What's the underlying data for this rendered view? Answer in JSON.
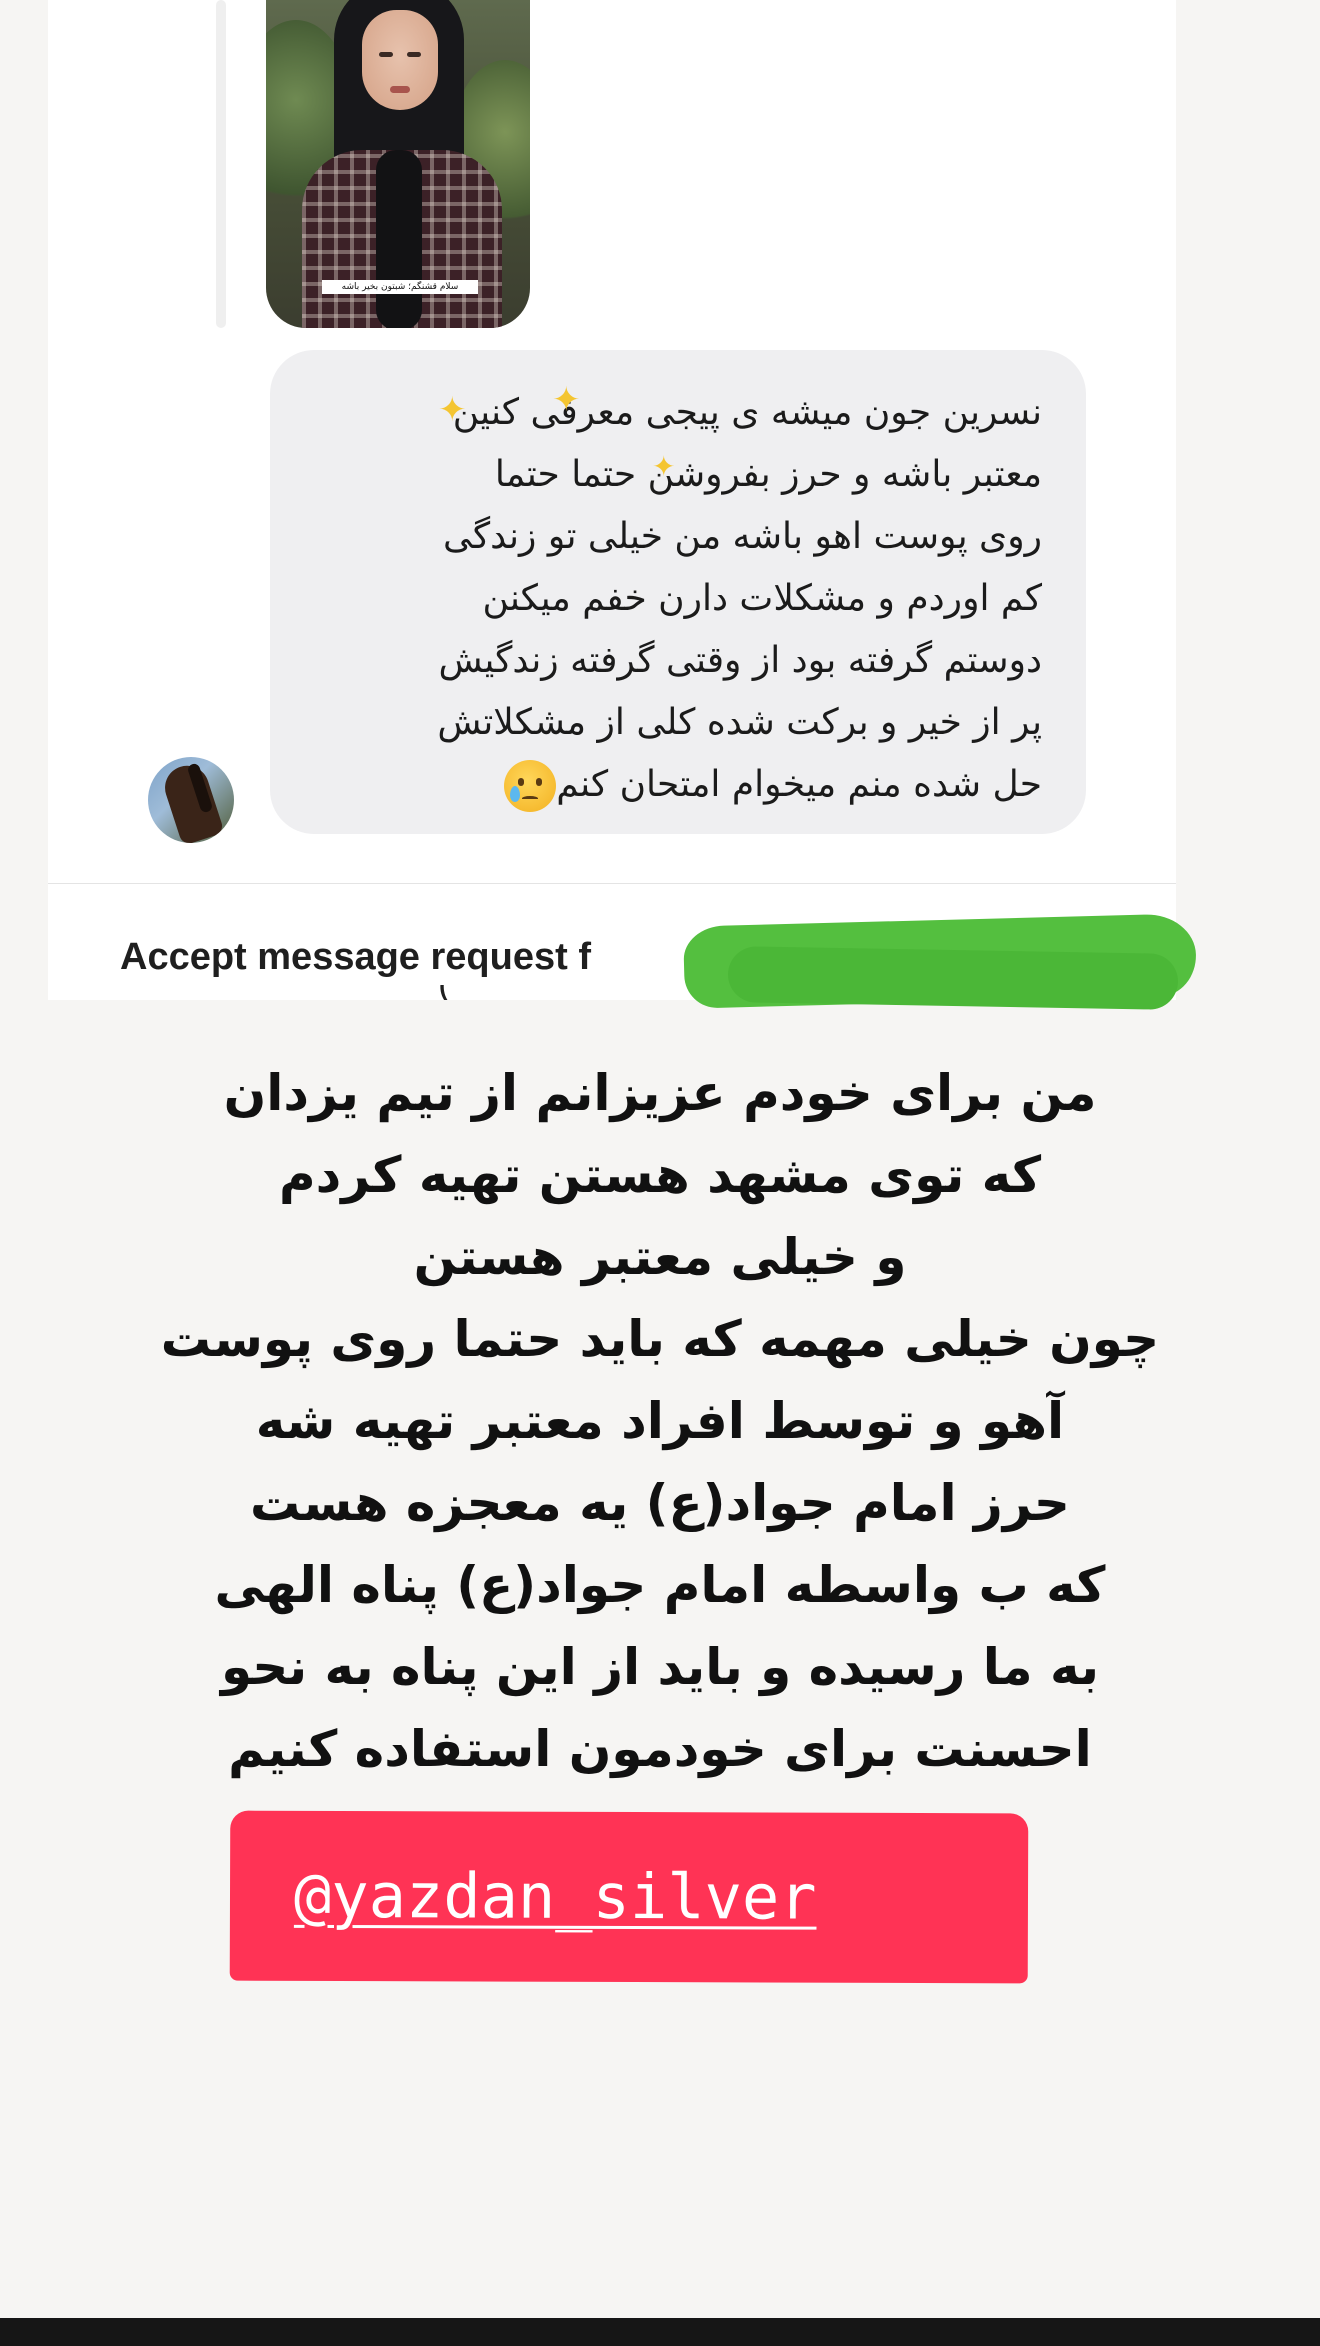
{
  "story": {
    "caption": "سلام قشنگم؛ شبتون بخیر باشه"
  },
  "message": {
    "lines": [
      "نسرین جون میشه ی پیجی معرفی کنین",
      "معتبر باشه و حرز بفروشن حتما حتما",
      "روی پوست اهو باشه من خیلی تو زندگی",
      "کم اوردم و مشکلات دارن خفم میکنن",
      "دوستم گرفته بود از وقتی گرفته زندگیش",
      "پر از خیر و برکت شده کلی از مشکلاتش",
      "حل شده منم میخوام امتحان کنم"
    ],
    "emoji": "crying-face"
  },
  "request": {
    "label": "Accept message request f"
  },
  "caption": {
    "lines": [
      "من برای خودم عزیزانم از تیم یزدان",
      "که توی مشهد هستن تهیه کردم",
      "و خیلی معتبر هستن",
      "چون خیلی مهمه که باید حتما روی پوست",
      "آهو و توسط افراد معتبر تهیه شه",
      "حرز امام جواد(ع) یه معجزه هست",
      "که ب واسطه امام جواد(ع)   پناه الهی",
      "به ما رسیده و باید از این پناه به نحو",
      "احسنت برای خودمون استفاده کنیم"
    ]
  },
  "handle": {
    "text": "@yazdan_silver"
  },
  "colors": {
    "bubble": "#efeff1",
    "redaction": "#54bf3f",
    "sticker": "#ff3355",
    "background": "#f6f5f3"
  }
}
